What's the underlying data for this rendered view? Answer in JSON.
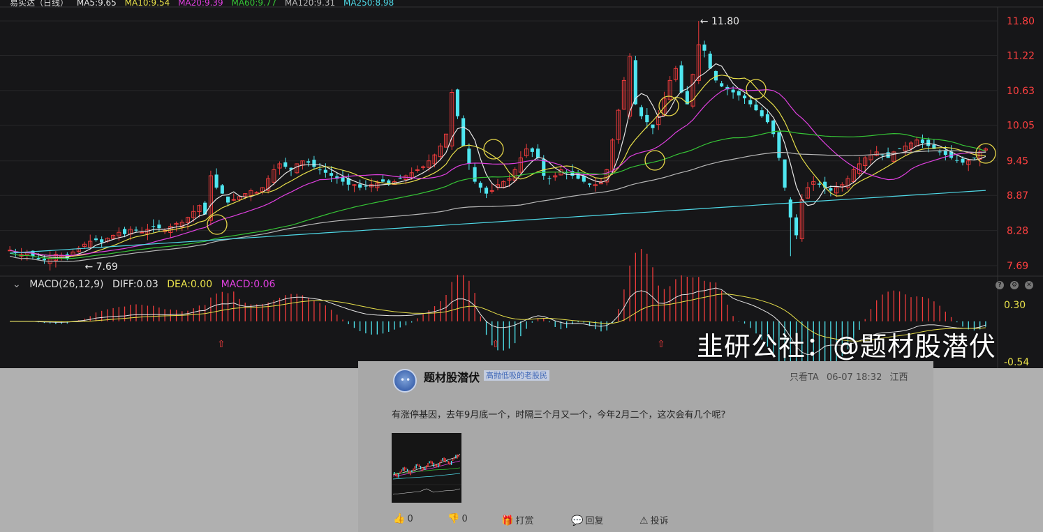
{
  "ma_header": {
    "title": "易实达（日线）",
    "items": [
      {
        "label": "MA5:9.65",
        "color": "#e6e6e6"
      },
      {
        "label": "MA10:9.54",
        "color": "#e8e04a"
      },
      {
        "label": "MA20:9.39",
        "color": "#e040e0"
      },
      {
        "label": "MA60:9.77",
        "color": "#36c436"
      },
      {
        "label": "MA120:9.31",
        "color": "#b8b8b8"
      },
      {
        "label": "MA250:8.98",
        "color": "#4fd8e6"
      }
    ]
  },
  "price_axis_labels": [
    "11.80",
    "11.22",
    "10.63",
    "10.05",
    "9.45",
    "8.87",
    "8.28",
    "7.69"
  ],
  "high_marker": "11.80",
  "low_marker": "7.69",
  "macd_header": {
    "chevron": "⌄",
    "name": "MACD(26,12,9)",
    "diff": "DIFF:0.03",
    "dea": "DEA:0.00",
    "macd": "MACD:0.06"
  },
  "macd_axis_labels": [
    "0.30",
    "-0.54"
  ],
  "toolbar_icons": [
    "help-icon",
    "gear-icon",
    "close-icon"
  ],
  "watermark": "韭研公社：@题材股潜伏",
  "post": {
    "author": "题材股潜伏",
    "badge": "高抛低吸的老股民",
    "only_view": "只看TA",
    "time": "06-07 18:32",
    "location": "江西",
    "text": "有涨停基因，去年9月底一个，时隔三个月又一个，今年2月二个，这次会有几个呢?",
    "like_count": "0",
    "dislike_count": "0",
    "reward_label": "打赏",
    "reply_label": "回复",
    "report_label": "投诉"
  },
  "colors": {
    "up": "#f03c3c",
    "down": "#4fe6f0",
    "background": "#161618",
    "ma5": "#e6e6e6",
    "ma10": "#e8e04a",
    "ma20": "#e040e0",
    "ma60": "#36c436",
    "ma120": "#b8b8b8",
    "ma250": "#4fd8e6",
    "axis_text": "#ff4040",
    "macd_axis_text": "#e8e04a"
  },
  "chart_data": {
    "type": "candlestick",
    "y_axis": {
      "range": [
        7.69,
        11.8
      ],
      "ticks": [
        11.8,
        11.22,
        10.63,
        10.05,
        9.45,
        8.87,
        8.28,
        7.69
      ]
    },
    "highest": 11.8,
    "lowest": 7.69,
    "closes": [
      7.95,
      7.9,
      7.88,
      7.92,
      7.85,
      7.8,
      7.78,
      7.82,
      7.88,
      7.86,
      7.8,
      7.92,
      7.98,
      8.05,
      8.1,
      8.12,
      8.08,
      8.15,
      8.2,
      8.25,
      8.22,
      8.3,
      8.28,
      8.25,
      8.3,
      8.35,
      8.32,
      8.28,
      8.35,
      8.4,
      8.42,
      8.5,
      8.6,
      8.7,
      8.55,
      9.2,
      9.0,
      8.9,
      8.75,
      8.8,
      8.85,
      8.9,
      8.95,
      8.92,
      9.0,
      9.15,
      9.3,
      9.4,
      9.35,
      9.3,
      9.4,
      9.45,
      9.42,
      9.35,
      9.3,
      9.25,
      9.2,
      9.15,
      9.1,
      9.05,
      9.05,
      9.0,
      9.02,
      9.05,
      9.08,
      9.1,
      9.05,
      9.1,
      9.15,
      9.2,
      9.25,
      9.3,
      9.35,
      9.45,
      9.55,
      9.7,
      9.9,
      10.6,
      10.2,
      9.7,
      9.4,
      9.1,
      9.0,
      8.9,
      8.95,
      9.05,
      9.1,
      9.15,
      9.3,
      9.5,
      9.65,
      9.6,
      9.5,
      9.2,
      9.15,
      9.2,
      9.3,
      9.25,
      9.2,
      9.15,
      9.1,
      9.05,
      9.05,
      9.1,
      9.3,
      9.8,
      10.3,
      10.8,
      11.2,
      10.4,
      10.2,
      10.1,
      10.0,
      10.2,
      10.5,
      10.8,
      11.0,
      10.6,
      10.4,
      10.9,
      11.4,
      11.3,
      11.0,
      10.8,
      10.7,
      10.65,
      10.6,
      10.55,
      10.5,
      10.4,
      10.3,
      10.2,
      10.1,
      9.9,
      9.5,
      9.0,
      8.5,
      8.2,
      8.8,
      9.0,
      9.1,
      9.05,
      9.0,
      8.95,
      9.0,
      9.05,
      9.15,
      9.3,
      9.4,
      9.5,
      9.55,
      9.6,
      9.55,
      9.5,
      9.6,
      9.65,
      9.7,
      9.75,
      9.8,
      9.75,
      9.7,
      9.65,
      9.6,
      9.55,
      9.5,
      9.45,
      9.42,
      9.45,
      9.5,
      9.6,
      9.65
    ],
    "macd_axis": {
      "range": [
        -0.54,
        0.3
      ]
    },
    "macd_signal_arrows": 3,
    "annotation_circles": 6
  }
}
